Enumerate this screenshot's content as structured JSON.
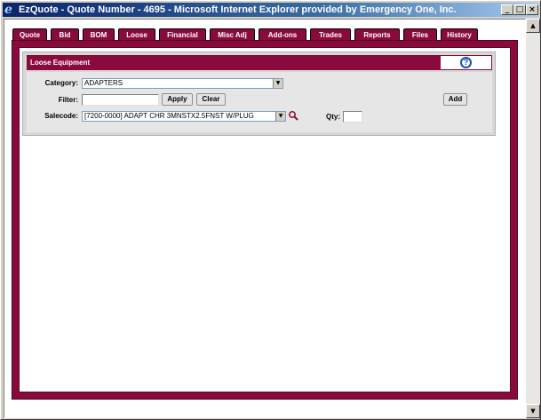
{
  "window": {
    "title": "EzQuote - Quote Number - 4695 - Microsoft Internet Explorer provided by Emergency One, Inc.",
    "controls": {
      "minimize": "_",
      "maximize": "□",
      "close": "×"
    }
  },
  "tabs": [
    {
      "label": "Quote"
    },
    {
      "label": "Bid"
    },
    {
      "label": "BOM"
    },
    {
      "label": "Loose"
    },
    {
      "label": "Financial"
    },
    {
      "label": "Misc Adj"
    },
    {
      "label": "Add-ons"
    },
    {
      "label": "Trades"
    },
    {
      "label": "Reports"
    },
    {
      "label": "Files"
    },
    {
      "label": "History"
    }
  ],
  "section": {
    "title": "Loose Equipment",
    "help_icon": "?"
  },
  "form": {
    "category_label": "Category:",
    "category_value": "ADAPTERS",
    "filter_label": "Filter:",
    "filter_value": "",
    "apply_label": "Apply",
    "clear_label": "Clear",
    "add_label": "Add",
    "salecode_label": "Salecode:",
    "salecode_value": "[7200-0000] ADAPT CHR 3MNSTX2.5FNST W/PLUG",
    "qty_label": "Qty:",
    "qty_value": ""
  },
  "colors": {
    "accent": "#8b0a3d",
    "titlebar_start": "#0a246a",
    "titlebar_end": "#a6caf0"
  },
  "scrollbar": {
    "up": "▲",
    "down": "▼"
  }
}
